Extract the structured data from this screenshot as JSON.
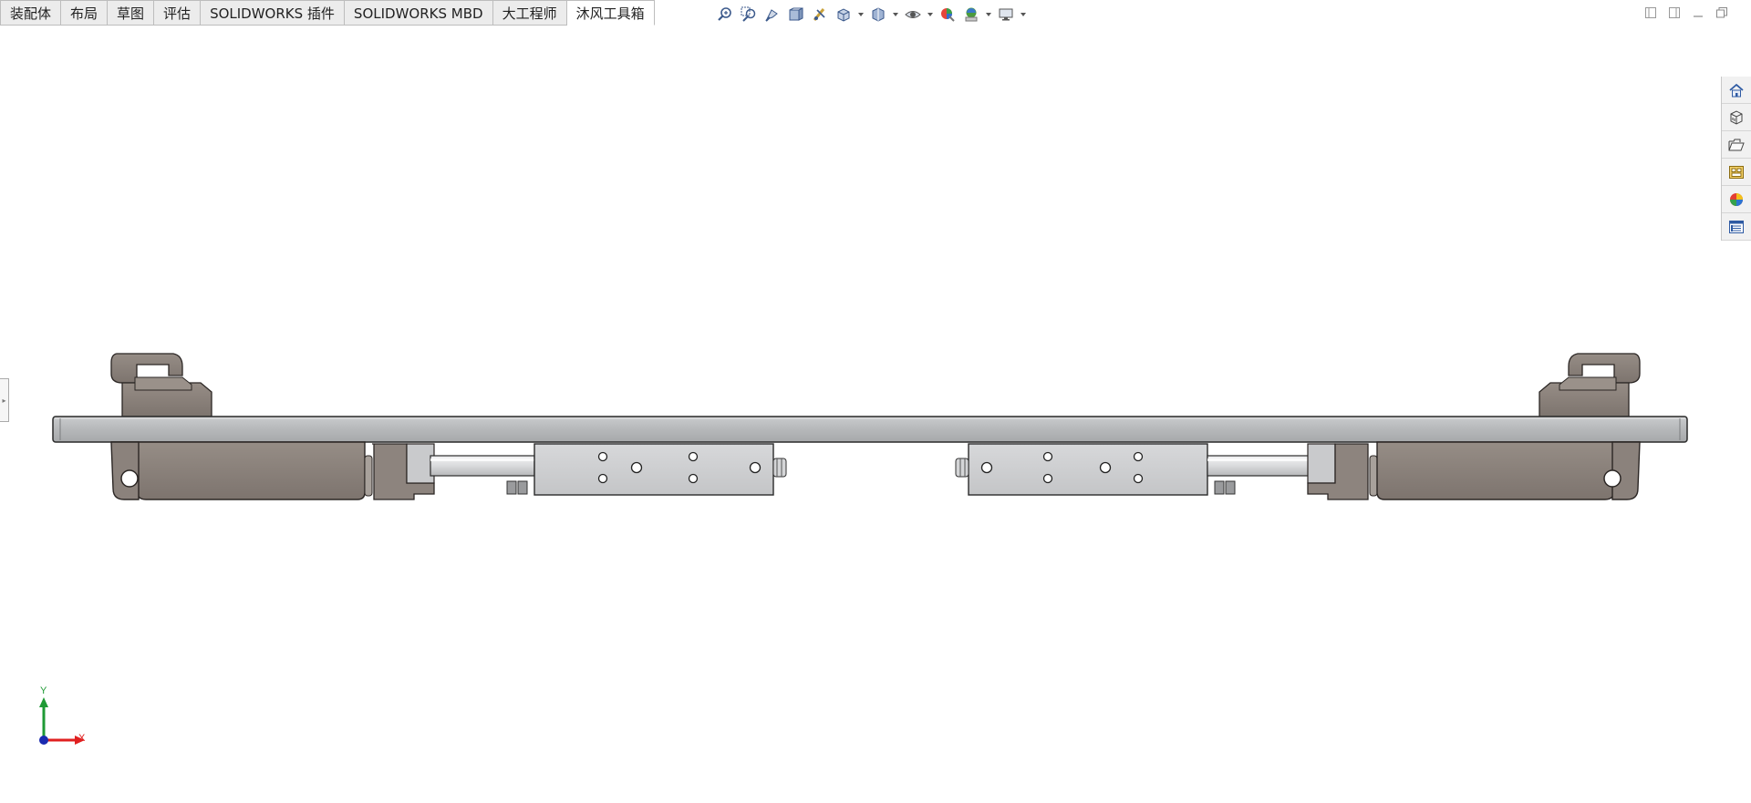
{
  "tabs": [
    {
      "label": "装配体",
      "active": false
    },
    {
      "label": "布局",
      "active": false
    },
    {
      "label": "草图",
      "active": false
    },
    {
      "label": "评估",
      "active": false
    },
    {
      "label": "SOLIDWORKS 插件",
      "active": false
    },
    {
      "label": "SOLIDWORKS MBD",
      "active": false
    },
    {
      "label": "大工程师",
      "active": false
    },
    {
      "label": "沐风工具箱",
      "active": true
    }
  ],
  "view_toolbar": {
    "icons": [
      "zoom-to-fit-icon",
      "zoom-to-area-icon",
      "previous-view-icon",
      "section-view-icon",
      "dynamic-annotation-icon",
      "view-orientation-icon",
      "display-style-icon",
      "hide-show-items-icon",
      "edit-appearance-icon",
      "apply-scene-icon",
      "view-settings-icon"
    ]
  },
  "window_controls": [
    "tile-left-icon",
    "tile-right-icon",
    "minimize-icon",
    "restore-icon"
  ],
  "task_pane": [
    "home-icon",
    "design-library-icon",
    "file-explorer-icon",
    "view-palette-icon",
    "appearances-icon",
    "custom-properties-icon"
  ],
  "triad": {
    "x_label": "X",
    "y_label": "Y",
    "x_color": "#e02020",
    "y_color": "#1f9a35",
    "origin_color": "#1a2bb0"
  },
  "colors": {
    "plate": "#b8babc",
    "housing": "#8a817b",
    "cylinder_body": "#d0d1d3",
    "rod": "#e4e5e7"
  }
}
